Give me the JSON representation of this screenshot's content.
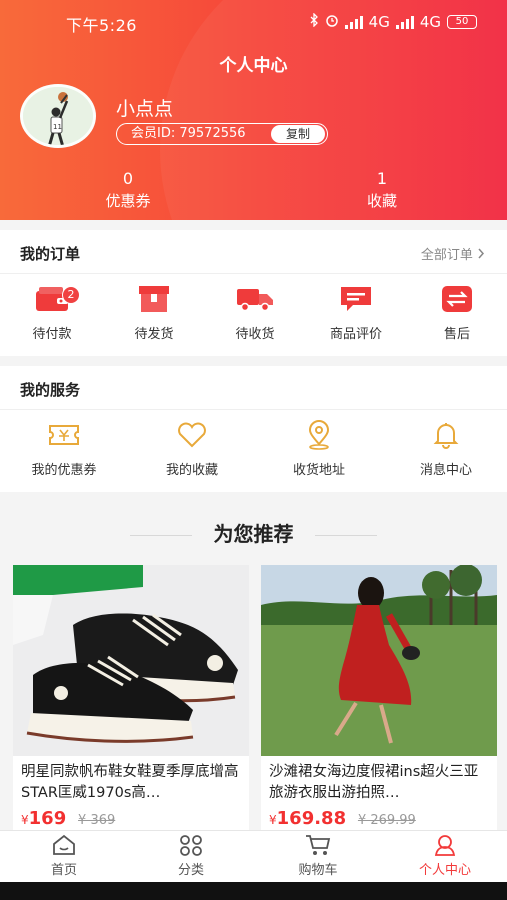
{
  "status_bar": {
    "time": "下午5:26",
    "network1": "4G",
    "network2": "4G",
    "battery": "50"
  },
  "header": {
    "title": "个人中心",
    "username": "小点点",
    "member_id": "会员ID: 79572556",
    "copy_label": "复制",
    "coupons": {
      "count": "0",
      "label": "优惠券"
    },
    "favorites": {
      "count": "1",
      "label": "收藏"
    }
  },
  "orders": {
    "title": "我的订单",
    "all_link": "全部订单",
    "items": [
      {
        "label": "待付款",
        "icon": "wallet-icon",
        "badge": "2"
      },
      {
        "label": "待发货",
        "icon": "package-icon"
      },
      {
        "label": "待收货",
        "icon": "truck-icon"
      },
      {
        "label": "商品评价",
        "icon": "comment-icon"
      },
      {
        "label": "售后",
        "icon": "exchange-icon"
      }
    ]
  },
  "services": {
    "title": "我的服务",
    "items": [
      {
        "label": "我的优惠券",
        "icon": "coupon-icon"
      },
      {
        "label": "我的收藏",
        "icon": "heart-icon"
      },
      {
        "label": "收货地址",
        "icon": "location-icon"
      },
      {
        "label": "消息中心",
        "icon": "bell-icon"
      }
    ]
  },
  "recommend": {
    "title": "为您推荐",
    "products": [
      {
        "name": "明星同款帆布鞋女鞋夏季厚底增高STAR匡威1970s高…",
        "currency": "¥",
        "price": "169",
        "old_price": "¥ 369"
      },
      {
        "name": "沙滩裙女海边度假裙ins超火三亚旅游衣服出游拍照…",
        "currency": "¥",
        "price": "169.88",
        "old_price": "¥ 269.99"
      }
    ]
  },
  "tabbar": {
    "items": [
      {
        "label": "首页",
        "icon": "home-icon"
      },
      {
        "label": "分类",
        "icon": "category-icon"
      },
      {
        "label": "购物车",
        "icon": "cart-icon"
      },
      {
        "label": "个人中心",
        "icon": "profile-icon",
        "active": true
      }
    ]
  },
  "colors": {
    "accent": "#f23a3a",
    "header_start": "#f86a3a",
    "header_end": "#f2283f",
    "service_icon": "#e8a93a"
  }
}
